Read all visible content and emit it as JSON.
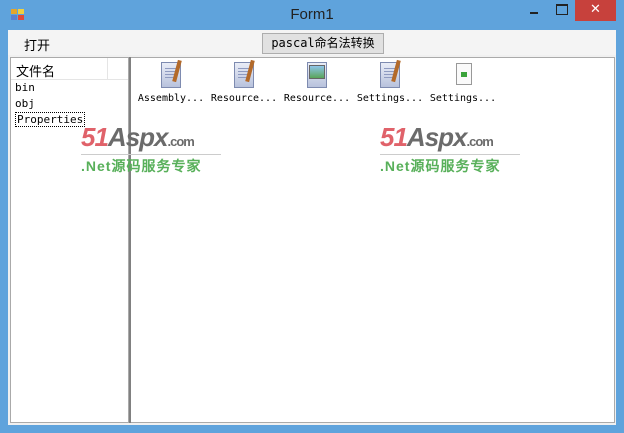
{
  "window": {
    "title": "Form1",
    "close_glyph": "✕"
  },
  "menu": {
    "open_label": "打开",
    "convert_button": "pascal命名法转换"
  },
  "file_list": {
    "header": "文件名",
    "items": [
      {
        "label": "bin"
      },
      {
        "label": "obj"
      },
      {
        "label": "Properties",
        "selected": true
      }
    ]
  },
  "files_view": {
    "items": [
      {
        "label": "Assembly...",
        "icon": "text-document-icon"
      },
      {
        "label": "Resource...",
        "icon": "text-document-icon"
      },
      {
        "label": "Resource...",
        "icon": "image-document-icon"
      },
      {
        "label": "Settings...",
        "icon": "text-document-icon"
      },
      {
        "label": "Settings...",
        "icon": "settings-file-icon"
      }
    ]
  },
  "watermark": {
    "logo_red": "51",
    "logo_gray": "Aspx",
    "logo_suffix": ".com",
    "tagline": ".Net源码服务专家"
  },
  "colors": {
    "border": "#5fa3dc",
    "close": "#c7413c",
    "watermark_red": "#e0626a",
    "watermark_green": "#58b05a"
  }
}
